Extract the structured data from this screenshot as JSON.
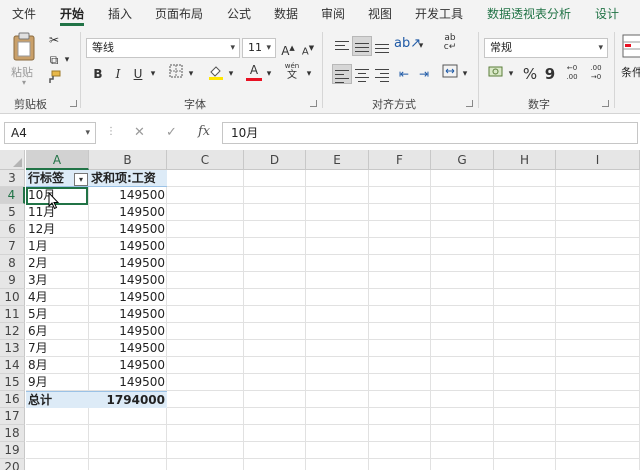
{
  "tabs": [
    "文件",
    "开始",
    "插入",
    "页面布局",
    "公式",
    "数据",
    "审阅",
    "视图",
    "开发工具",
    "数据透视表分析",
    "设计"
  ],
  "active_tab": "开始",
  "ribbon": {
    "clipboard": {
      "paste_label": "粘贴",
      "group_label": "剪贴板"
    },
    "font": {
      "font_name": "等线",
      "font_size": "11",
      "grow": "A",
      "shrink": "A",
      "bold": "B",
      "italic": "I",
      "underline": "U",
      "font_color_letter": "A",
      "phonetic": "wén",
      "group_label": "字体"
    },
    "alignment": {
      "group_label": "对齐方式"
    },
    "number": {
      "format": "常规",
      "percent": "%",
      "comma": "9",
      "inc_decimal": "←0 .00",
      "dec_decimal": ".00 →0",
      "group_label": "数字"
    },
    "styles": {
      "conditional_label": "条件"
    }
  },
  "formula_bar": {
    "name_box": "A4",
    "cancel": "✕",
    "enter": "✓",
    "fx": "fx",
    "value": "10月"
  },
  "grid": {
    "columns": [
      "A",
      "B",
      "C",
      "D",
      "E",
      "F",
      "G",
      "H",
      "I"
    ],
    "rows": [
      "3",
      "4",
      "5",
      "6",
      "7",
      "8",
      "9",
      "10",
      "11",
      "12",
      "13",
      "14",
      "15",
      "16",
      "17",
      "18",
      "19",
      "20"
    ],
    "pivot": {
      "row_label_header": "行标签",
      "value_header": "求和项:工资",
      "items": [
        {
          "label": "10月",
          "value": "149500"
        },
        {
          "label": "11月",
          "value": "149500"
        },
        {
          "label": "12月",
          "value": "149500"
        },
        {
          "label": "1月",
          "value": "149500"
        },
        {
          "label": "2月",
          "value": "149500"
        },
        {
          "label": "3月",
          "value": "149500"
        },
        {
          "label": "4月",
          "value": "149500"
        },
        {
          "label": "5月",
          "value": "149500"
        },
        {
          "label": "6月",
          "value": "149500"
        },
        {
          "label": "7月",
          "value": "149500"
        },
        {
          "label": "8月",
          "value": "149500"
        },
        {
          "label": "9月",
          "value": "149500"
        }
      ],
      "total_label": "总计",
      "total_value": "1794000"
    }
  },
  "colors": {
    "accent": "#217346",
    "pivot_header_fill": "#ddebf7",
    "ribbon_bg": "#f3f3f3"
  }
}
